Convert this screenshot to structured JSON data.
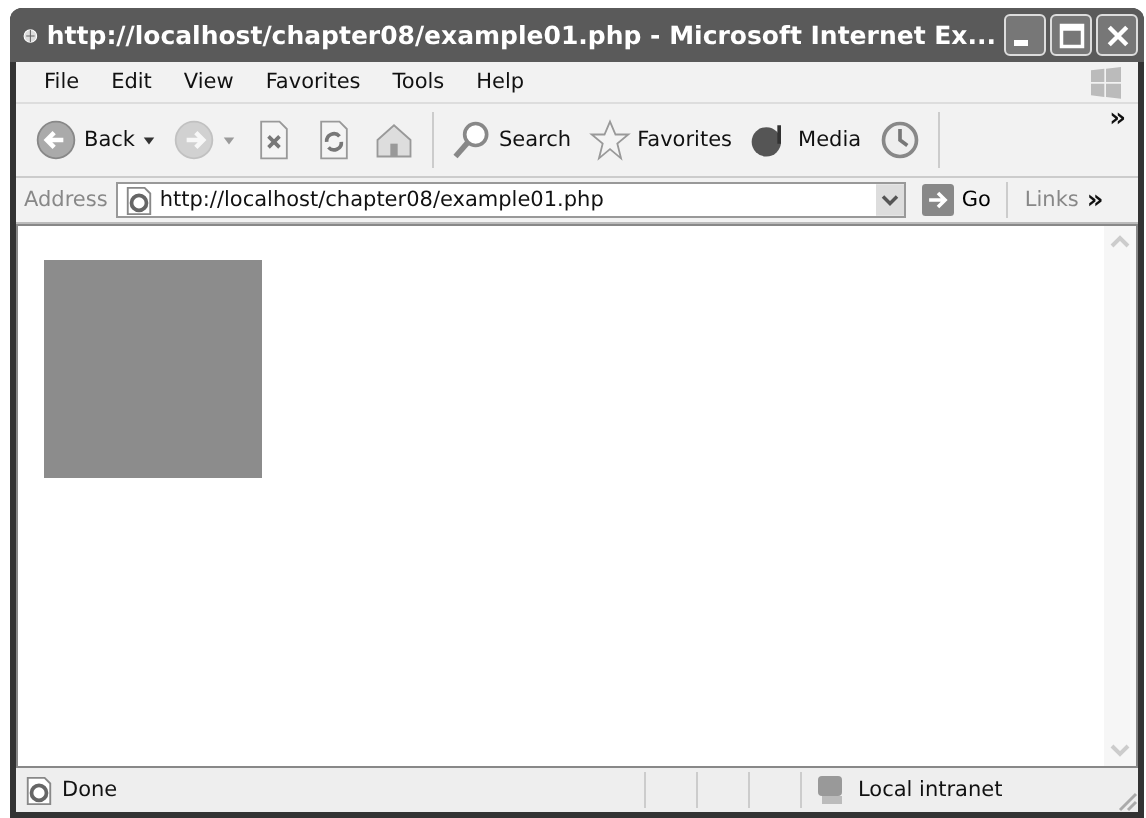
{
  "window": {
    "title": "http://localhost/chapter08/example01.php - Microsoft Internet Ex..."
  },
  "menu": [
    "File",
    "Edit",
    "View",
    "Favorites",
    "Tools",
    "Help"
  ],
  "toolbar": [
    {
      "kind": "back",
      "label": "Back",
      "dropdown": true,
      "disabled": false
    },
    {
      "kind": "forward",
      "dropdown": true,
      "disabled": true
    },
    {
      "kind": "stop",
      "disabled": false
    },
    {
      "kind": "refresh",
      "disabled": false
    },
    {
      "kind": "home",
      "disabled": false
    },
    {
      "kind": "search",
      "label": "Search",
      "disabled": false
    },
    {
      "kind": "favorites",
      "label": "Favorites",
      "disabled": false
    },
    {
      "kind": "media",
      "label": "Media",
      "disabled": false
    },
    {
      "kind": "history",
      "disabled": false
    }
  ],
  "toolbar_more": "»",
  "address": {
    "label": "Address",
    "url": "http://localhost/chapter08/example01.php",
    "go": "Go",
    "links": "Links",
    "links_more": "»"
  },
  "status_bar": {
    "text": "Done",
    "zone": "Local intranet"
  }
}
